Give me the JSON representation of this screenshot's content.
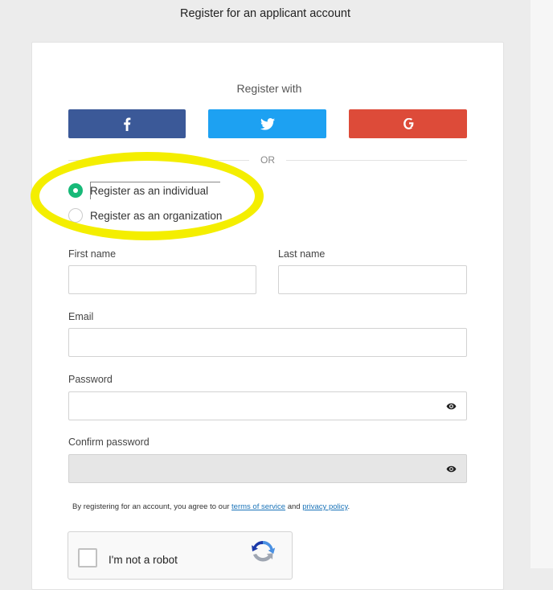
{
  "page": {
    "title": "Register for an applicant account"
  },
  "social": {
    "heading": "Register with",
    "facebook_icon": "facebook-icon",
    "twitter_icon": "twitter-icon",
    "google_icon": "google-icon",
    "colors": {
      "facebook": "#3b5998",
      "twitter": "#1da1f2",
      "google": "#dd4b39"
    }
  },
  "divider": {
    "text": "OR"
  },
  "account_type": {
    "options": [
      {
        "label": "Register as an individual",
        "selected": true
      },
      {
        "label": "Register as an organization",
        "selected": false
      }
    ],
    "accent": "#17b978"
  },
  "form": {
    "first_name_label": "First name",
    "last_name_label": "Last name",
    "email_label": "Email",
    "password_label": "Password",
    "confirm_password_label": "Confirm password",
    "first_name_value": "",
    "last_name_value": "",
    "email_value": "",
    "password_value": "",
    "confirm_password_value": ""
  },
  "terms": {
    "prefix": "By registering for an account, you agree to our ",
    "terms_link": "terms of service",
    "middle": " and ",
    "privacy_link": "privacy policy",
    "suffix": "."
  },
  "captcha": {
    "label": "I'm not a robot"
  },
  "highlight": {
    "color": "#f4ee00"
  }
}
